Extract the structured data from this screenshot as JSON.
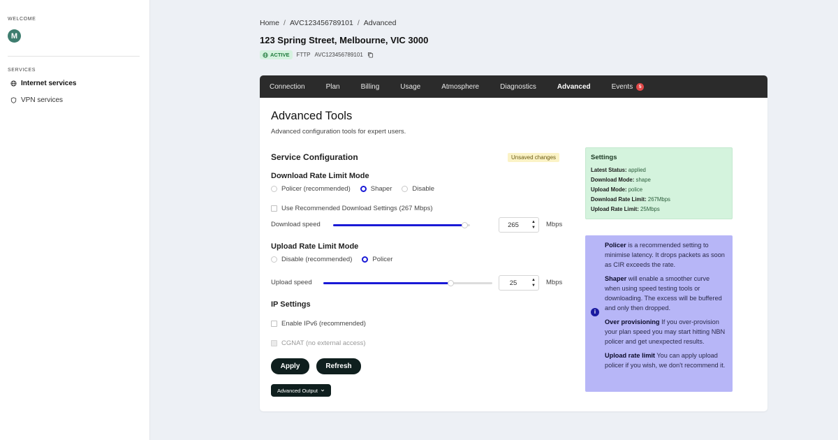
{
  "sidebar": {
    "welcome_label": "WELCOME",
    "avatar_initial": "M",
    "services_label": "SERVICES",
    "items": [
      {
        "label": "Internet services",
        "icon": "globe-icon",
        "active": true
      },
      {
        "label": "VPN services",
        "icon": "shield-icon",
        "active": false
      }
    ]
  },
  "breadcrumb": [
    "Home",
    "AVC123456789101",
    "Advanced"
  ],
  "breadcrumb_sep": "/",
  "header": {
    "address": "123 Spring Street, Melbourne, VIC 3000",
    "status": "ACTIVE",
    "tech": "FTTP",
    "avc": "AVC123456789101"
  },
  "tabs": [
    {
      "label": "Connection"
    },
    {
      "label": "Plan"
    },
    {
      "label": "Billing"
    },
    {
      "label": "Usage"
    },
    {
      "label": "Atmosphere"
    },
    {
      "label": "Diagnostics"
    },
    {
      "label": "Advanced",
      "active": true
    },
    {
      "label": "Events",
      "badge": "5"
    }
  ],
  "page": {
    "title": "Advanced Tools",
    "subtitle": "Advanced configuration tools for expert users."
  },
  "service_config": {
    "heading": "Service Configuration",
    "unsaved": "Unsaved changes",
    "download_mode_heading": "Download Rate Limit Mode",
    "download_options": [
      "Policer (recommended)",
      "Shaper",
      "Disable"
    ],
    "download_selected": "Shaper",
    "use_recommended_label": "Use Recommended Download Settings (267 Mbps)",
    "download_speed_label": "Download speed",
    "download_speed_value": "265",
    "download_speed_fraction": 0.96,
    "unit": "Mbps",
    "upload_mode_heading": "Upload Rate Limit Mode",
    "upload_options": [
      "Disable (recommended)",
      "Policer"
    ],
    "upload_selected": "Policer",
    "upload_speed_label": "Upload speed",
    "upload_speed_value": "25",
    "upload_speed_fraction": 0.75
  },
  "ip_settings": {
    "heading": "IP Settings",
    "ipv6_label": "Enable IPv6 (recommended)",
    "cgnat_label": "CGNAT (no external access)"
  },
  "buttons": {
    "apply": "Apply",
    "refresh": "Refresh",
    "advanced_output": "Advanced Output"
  },
  "settings_panel": {
    "heading": "Settings",
    "rows": [
      {
        "key": "Latest Status:",
        "value": "applied"
      },
      {
        "key": "Download Mode:",
        "value": "shape"
      },
      {
        "key": "Upload Mode:",
        "value": "police"
      },
      {
        "key": "Download Rate Limit:",
        "value": "267Mbps"
      },
      {
        "key": "Upload Rate Limit:",
        "value": "25Mbps"
      }
    ]
  },
  "info_panel": {
    "items": [
      {
        "term": "Policer",
        "text": " is a recommended setting to minimise latency. It drops packets as soon as CIR exceeds the rate."
      },
      {
        "term": "Shaper",
        "text": " will enable a smoother curve when using speed testing tools or downloading. The excess will be buffered and only then dropped."
      },
      {
        "term": "Over provisioning",
        "text": " If you over-provision your plan speed you may start hitting NBN policer and get unexpected results."
      },
      {
        "term": "Upload rate limit",
        "text": " You can apply upload policer if you wish, we don't recommend it."
      }
    ]
  },
  "colors": {
    "accent": "#1a1ad6",
    "tabbar": "#2b2b2b",
    "settings_bg": "#d4f3dd",
    "info_bg": "#b7b6f7"
  }
}
